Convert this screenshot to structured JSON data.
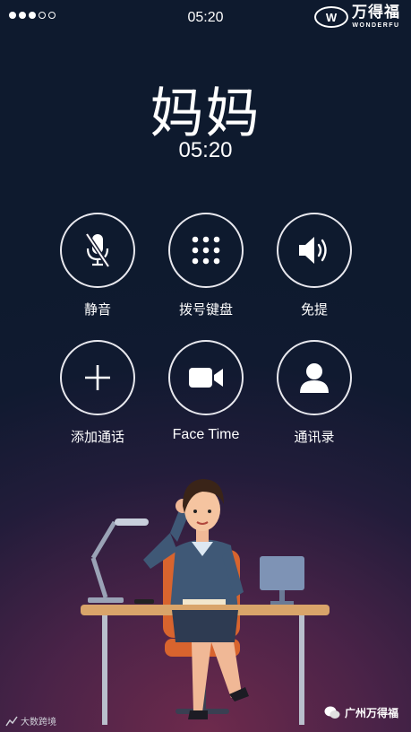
{
  "status_bar": {
    "signal_filled": 3,
    "signal_total": 5,
    "time": "05:20"
  },
  "brand": {
    "logo_letter": "W",
    "name_cn": "万得福",
    "name_en": "WONDERFU"
  },
  "call": {
    "caller_name": "妈妈",
    "duration": "05:20"
  },
  "controls": [
    {
      "label": "静音",
      "icon": "mic-muted-icon"
    },
    {
      "label": "拨号键盘",
      "icon": "keypad-icon"
    },
    {
      "label": "免提",
      "icon": "speaker-icon"
    },
    {
      "label": "添加通话",
      "icon": "plus-icon"
    },
    {
      "label": "Face Time",
      "icon": "video-camera-icon"
    },
    {
      "label": "通讯录",
      "icon": "contact-person-icon"
    }
  ],
  "watermarks": {
    "left_text": "大数跨境",
    "right_text": "广州万得福"
  },
  "colors": {
    "background_top": "#0e1a2e",
    "background_bottom": "#6e2a4c",
    "desk_top": "#d9a46a",
    "chair": "#d8642e"
  }
}
